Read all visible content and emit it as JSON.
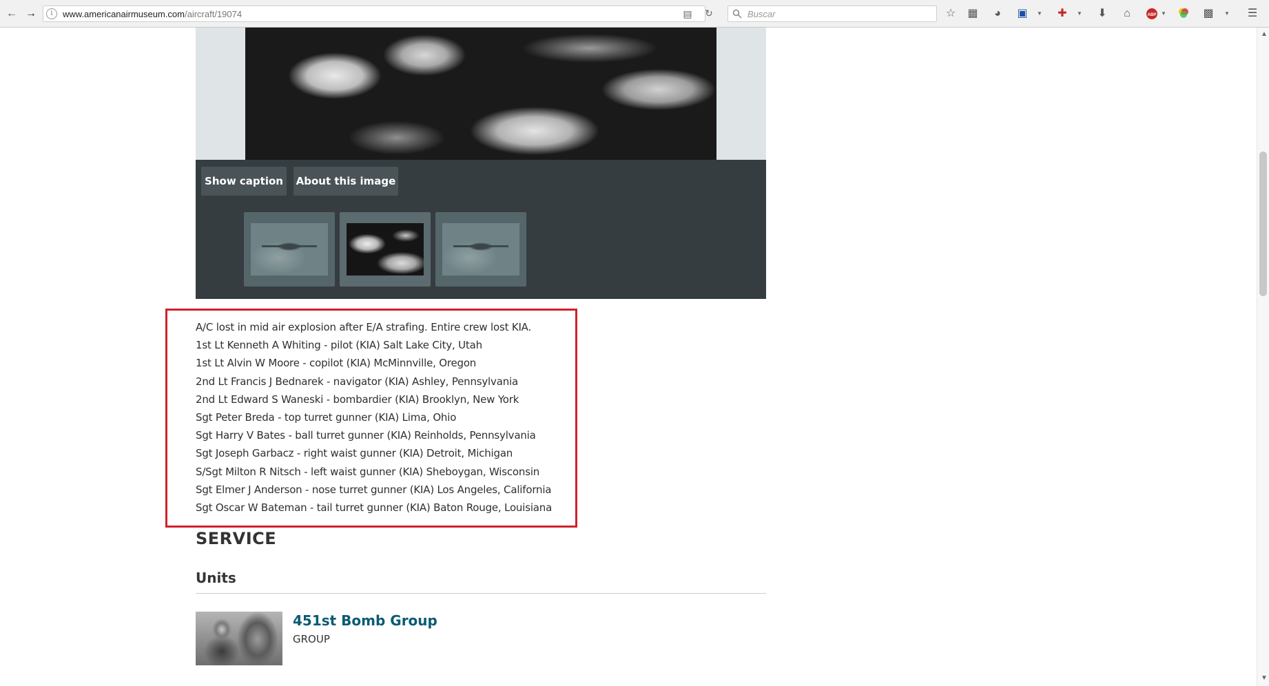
{
  "browser": {
    "url_domain": "www.americanairmuseum.com",
    "url_path": "/aircraft/19074",
    "search_placeholder": "Buscar",
    "info_label": "i",
    "abp_label": "ABP",
    "icons": [
      "back-arrow-icon",
      "forward-arrow-icon",
      "info-icon",
      "reader-view-icon",
      "reload-icon",
      "search-icon",
      "bookmark-star-icon",
      "bookmarks-list-icon",
      "pocket-icon",
      "save-disk-icon",
      "first-aid-icon",
      "download-icon",
      "home-icon",
      "adblock-icon",
      "color-wheel-icon",
      "clipboard-icon",
      "hamburger-menu-icon"
    ]
  },
  "gallery": {
    "show_caption_label": "Show caption",
    "about_image_label": "About this image"
  },
  "caption": {
    "lines": [
      "A/C lost in mid air explosion after E/A strafing. Entire crew lost KIA.",
      "1st Lt Kenneth A Whiting - pilot (KIA) Salt Lake City, Utah",
      "1st Lt Alvin W Moore - copilot (KIA) McMinnville, Oregon",
      "2nd Lt Francis J Bednarek - navigator (KIA) Ashley, Pennsylvania",
      "2nd Lt Edward S Waneski - bombardier (KIA) Brooklyn, New York",
      "Sgt Peter Breda - top turret gunner (KIA) Lima, Ohio",
      "Sgt Harry V Bates - ball turret gunner (KIA) Reinholds, Pennsylvania",
      "Sgt Joseph Garbacz - right waist gunner (KIA) Detroit, Michigan",
      "S/Sgt Milton R Nitsch - left waist gunner (KIA) Sheboygan, Wisconsin",
      "Sgt Elmer J Anderson - nose turret gunner (KIA) Los Angeles, California",
      "Sgt Oscar W Bateman - tail turret gunner (KIA) Baton Rouge, Louisiana"
    ]
  },
  "service": {
    "heading": "SERVICE",
    "units_heading": "Units",
    "unit": {
      "name": "451st Bomb Group",
      "type": "GROUP"
    }
  },
  "colors": {
    "highlight_border": "#d0212a",
    "link": "#0b5a73",
    "caption_bar": "#353d40"
  }
}
